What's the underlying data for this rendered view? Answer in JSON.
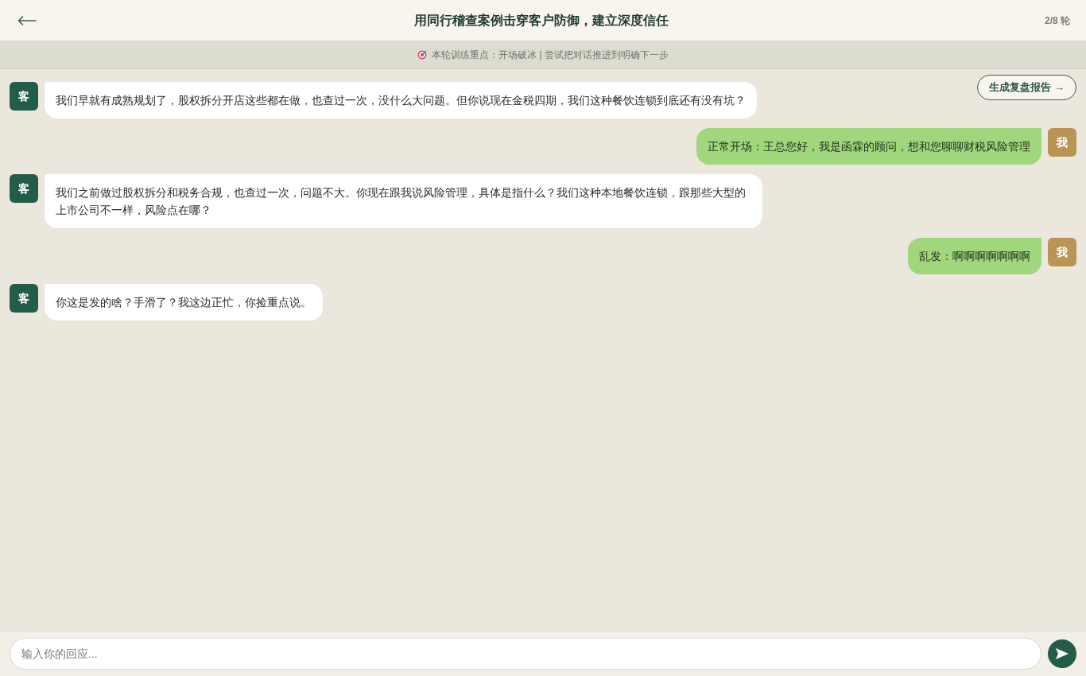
{
  "header": {
    "title": "用同行稽查案例击穿客户防御，建立深度信任",
    "round": "2/8 轮"
  },
  "focus_bar": {
    "text": "本轮训练重点：开场破冰 | 尝试把对话推进到明确下一步"
  },
  "report_button": {
    "label": "生成复盘报告 →"
  },
  "messages": [
    {
      "kind": "customer",
      "avatar": "客",
      "text": "我们早就有成熟规划了，股权拆分开店这些都在做，也查过一次，没什么大问题。但你说现在金税四期，我们这种餐饮连锁到底还有没有坑？"
    },
    {
      "kind": "me",
      "avatar": "我",
      "text": "正常开场：王总您好，我是函霖的顾问，想和您聊聊财税风险管理"
    },
    {
      "kind": "customer",
      "avatar": "客",
      "text": "我们之前做过股权拆分和税务合规，也查过一次，问题不大。你现在跟我说风险管理，具体是指什么？我们这种本地餐饮连锁，跟那些大型的上市公司不一样，风险点在哪？"
    },
    {
      "kind": "me",
      "avatar": "我",
      "text": "乱发：啊啊啊啊啊啊啊"
    },
    {
      "kind": "customer",
      "avatar": "客",
      "text": "你这是发的啥？手滑了？我这边正忙，你捡重点说。"
    }
  ],
  "composer": {
    "placeholder": "输入你的回应..."
  }
}
